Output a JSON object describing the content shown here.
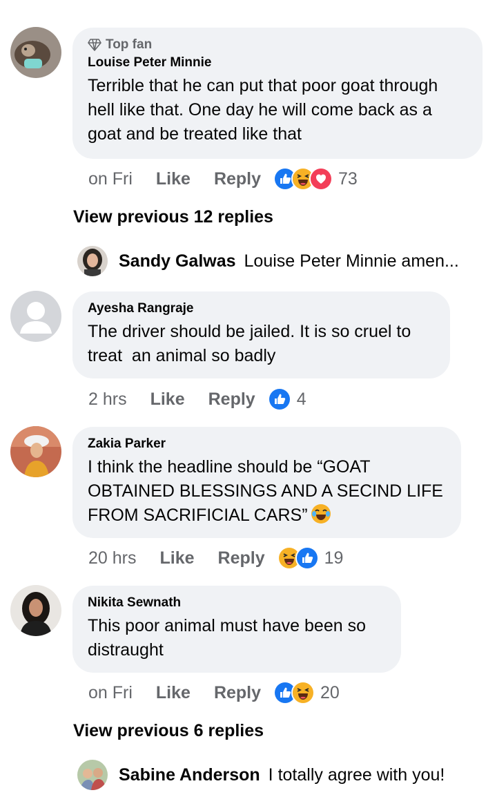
{
  "comments": [
    {
      "badge": "Top fan",
      "author": "Louise Peter Minnie",
      "text": "Terrible that he can put that poor goat through\nhell like that. One day he will come back as a\ngoat and be treated like that",
      "time": "on Fri",
      "like_label": "Like",
      "reply_label": "Reply",
      "reaction_icons": [
        "like-icon",
        "haha-icon",
        "love-icon"
      ],
      "reaction_count": "73"
    },
    {
      "author": "Ayesha Rangraje",
      "text": "The driver should be jailed. It is so cruel to\ntreat  an animal so badly",
      "time": "2 hrs",
      "like_label": "Like",
      "reply_label": "Reply",
      "reaction_icons": [
        "like-icon"
      ],
      "reaction_count": "4"
    },
    {
      "author": "Zakia Parker",
      "text": "I think the headline should be “GOAT\nOBTAINED BLESSINGS AND A SECIND LIFE\nFROM SACRIFICIAL CARS”",
      "time": "20 hrs",
      "like_label": "Like",
      "reply_label": "Reply",
      "reaction_icons": [
        "haha-icon",
        "like-icon"
      ],
      "reaction_count": "19"
    },
    {
      "author": "Nikita Sewnath",
      "text": "This poor animal must have been so\ndistraught",
      "time": "on Fri",
      "like_label": "Like",
      "reply_label": "Reply",
      "reaction_icons": [
        "like-icon",
        "haha-icon"
      ],
      "reaction_count": "20"
    }
  ],
  "threads": [
    {
      "view_previous": "View previous 12 replies",
      "reply_author": "Sandy Galwas",
      "reply_text": "Louise Peter Minnie amen..."
    },
    {
      "view_previous": "View previous 6 replies",
      "reply_author": "Sabine Anderson",
      "reply_text": "I totally agree with you!"
    }
  ],
  "colors": {
    "bubble": "#f0f2f5",
    "like_blue": "#1877f2",
    "love_red": "#f33e58",
    "haha_yellow": "#f7b125",
    "meta_gray": "#65676b"
  }
}
